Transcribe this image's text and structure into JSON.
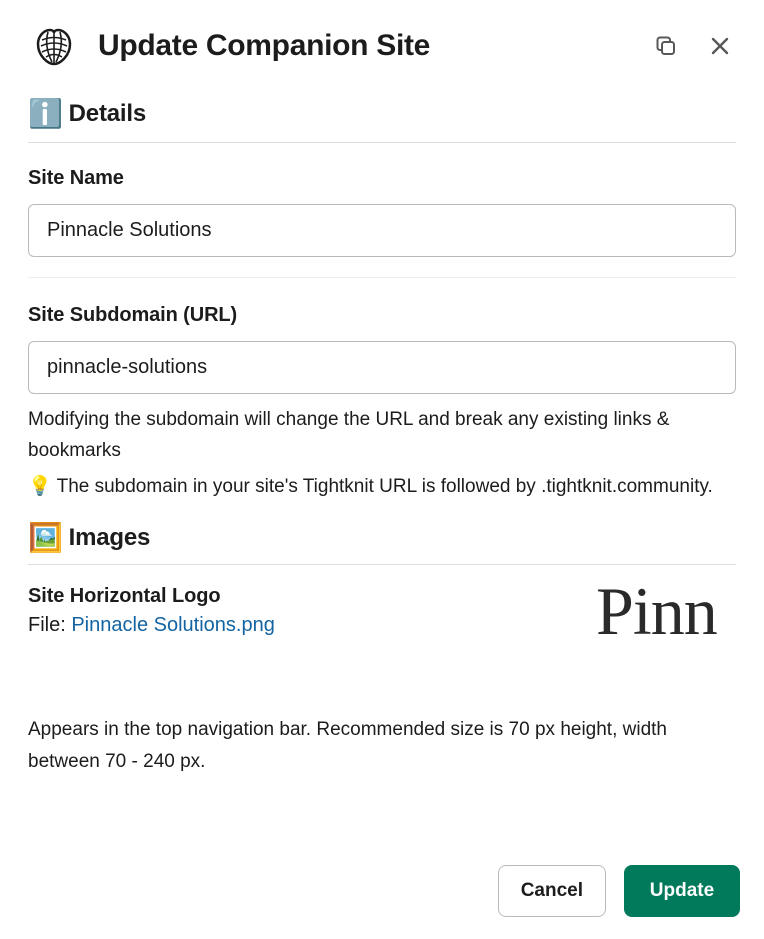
{
  "header": {
    "title": "Update Companion Site",
    "logo_emoji": "🧶"
  },
  "details": {
    "heading": "Details",
    "heading_emoji": "ℹ️",
    "site_name": {
      "label": "Site Name",
      "value": "Pinnacle Solutions"
    },
    "subdomain": {
      "label": "Site Subdomain (URL)",
      "value": "pinnacle-solutions",
      "helper": "Modifying the subdomain will change the URL and break any existing links & bookmarks",
      "bulb_tip": "💡 The subdomain in your site's Tightknit URL is followed by .tightknit.community."
    }
  },
  "images": {
    "heading": "Images",
    "heading_emoji": "🖼️",
    "horizontal_logo": {
      "label": "Site Horizontal Logo",
      "file_prefix": "File: ",
      "file_name": "Pinnacle Solutions.png",
      "preview_text": "Pinn",
      "description": "Appears in the top navigation bar. Recommended size is 70 px height, width between 70 - 240 px."
    }
  },
  "footer": {
    "cancel": "Cancel",
    "update": "Update"
  }
}
